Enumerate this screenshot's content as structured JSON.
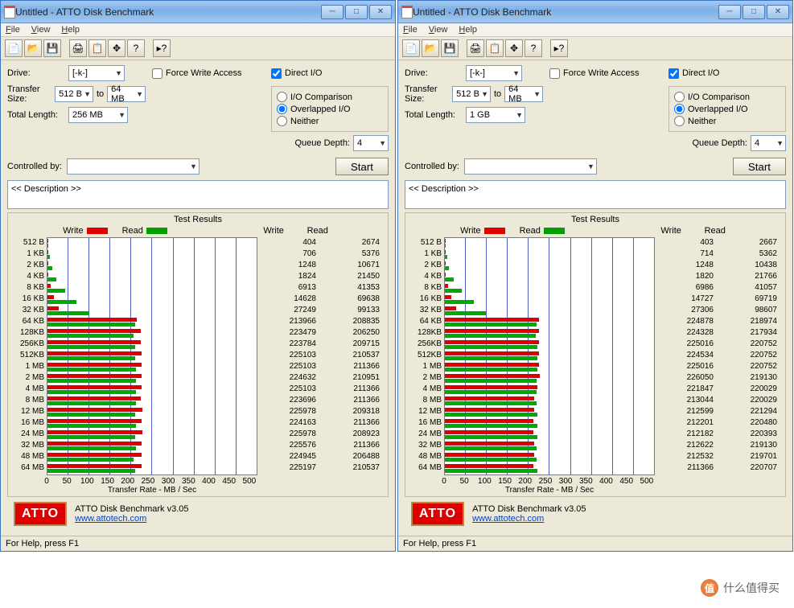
{
  "windows": [
    {
      "title": "Untitled - ATTO Disk Benchmark",
      "menu": {
        "file": "File",
        "view": "View",
        "help": "Help"
      },
      "form": {
        "drive_label": "Drive:",
        "drive_value": "[-k-]",
        "transfer_label": "Transfer Size:",
        "transfer_from": "512 B",
        "transfer_to_label": "to",
        "transfer_to": "64 MB",
        "length_label": "Total Length:",
        "length_value": "256 MB",
        "force_write": "Force Write Access",
        "direct_io": "Direct I/O",
        "io_comparison": "I/O Comparison",
        "overlapped_io": "Overlapped I/O",
        "neither": "Neither",
        "queue_label": "Queue Depth:",
        "queue_value": "4",
        "controlled_label": "Controlled by:",
        "start": "Start",
        "description": "<< Description >>"
      },
      "results_title": "Test Results",
      "legend": {
        "write": "Write",
        "read": "Read"
      },
      "colors": {
        "write": "#e00000",
        "read": "#00a000"
      },
      "value_headers": {
        "write": "Write",
        "read": "Read"
      },
      "chart_data": {
        "type": "bar",
        "xlabel": "Transfer Rate - MB / Sec",
        "xlim": [
          0,
          500
        ],
        "xticks": [
          0,
          50,
          100,
          150,
          200,
          250,
          300,
          350,
          400,
          450,
          500
        ],
        "rows": [
          {
            "label": "512 B",
            "write": 404,
            "read": 2674
          },
          {
            "label": "1 KB",
            "write": 706,
            "read": 5376
          },
          {
            "label": "2 KB",
            "write": 1248,
            "read": 10671
          },
          {
            "label": "4 KB",
            "write": 1824,
            "read": 21450
          },
          {
            "label": "8 KB",
            "write": 6913,
            "read": 41353
          },
          {
            "label": "16 KB",
            "write": 14628,
            "read": 69638
          },
          {
            "label": "32 KB",
            "write": 27249,
            "read": 99133
          },
          {
            "label": "64 KB",
            "write": 213966,
            "read": 208835
          },
          {
            "label": "128KB",
            "write": 223479,
            "read": 206250
          },
          {
            "label": "256KB",
            "write": 223784,
            "read": 209715
          },
          {
            "label": "512KB",
            "write": 225103,
            "read": 210537
          },
          {
            "label": "1 MB",
            "write": 225103,
            "read": 211366
          },
          {
            "label": "2 MB",
            "write": 224632,
            "read": 210951
          },
          {
            "label": "4 MB",
            "write": 225103,
            "read": 211366
          },
          {
            "label": "8 MB",
            "write": 223696,
            "read": 211366
          },
          {
            "label": "12 MB",
            "write": 225978,
            "read": 209318
          },
          {
            "label": "16 MB",
            "write": 224163,
            "read": 211366
          },
          {
            "label": "24 MB",
            "write": 225978,
            "read": 208923
          },
          {
            "label": "32 MB",
            "write": 225576,
            "read": 211366
          },
          {
            "label": "48 MB",
            "write": 224945,
            "read": 206488
          },
          {
            "label": "64 MB",
            "write": 225197,
            "read": 210537
          }
        ]
      },
      "footer": {
        "product": "ATTO Disk Benchmark v3.05",
        "url": "www.attotech.com",
        "logo": "ATTO"
      },
      "status": "For Help, press F1"
    },
    {
      "title": "Untitled - ATTO Disk Benchmark",
      "menu": {
        "file": "File",
        "view": "View",
        "help": "Help"
      },
      "form": {
        "drive_label": "Drive:",
        "drive_value": "[-k-]",
        "transfer_label": "Transfer Size:",
        "transfer_from": "512 B",
        "transfer_to_label": "to",
        "transfer_to": "64 MB",
        "length_label": "Total Length:",
        "length_value": "1 GB",
        "force_write": "Force Write Access",
        "direct_io": "Direct I/O",
        "io_comparison": "I/O Comparison",
        "overlapped_io": "Overlapped I/O",
        "neither": "Neither",
        "queue_label": "Queue Depth:",
        "queue_value": "4",
        "controlled_label": "Controlled by:",
        "start": "Start",
        "description": "<< Description >>"
      },
      "results_title": "Test Results",
      "legend": {
        "write": "Write",
        "read": "Read"
      },
      "colors": {
        "write": "#e00000",
        "read": "#00a000"
      },
      "value_headers": {
        "write": "Write",
        "read": "Read"
      },
      "chart_data": {
        "type": "bar",
        "xlabel": "Transfer Rate - MB / Sec",
        "xlim": [
          0,
          500
        ],
        "xticks": [
          0,
          50,
          100,
          150,
          200,
          250,
          300,
          350,
          400,
          450,
          500
        ],
        "rows": [
          {
            "label": "512 B",
            "write": 403,
            "read": 2667
          },
          {
            "label": "1 KB",
            "write": 714,
            "read": 5362
          },
          {
            "label": "2 KB",
            "write": 1248,
            "read": 10438
          },
          {
            "label": "4 KB",
            "write": 1820,
            "read": 21766
          },
          {
            "label": "8 KB",
            "write": 6986,
            "read": 41057
          },
          {
            "label": "16 KB",
            "write": 14727,
            "read": 69719
          },
          {
            "label": "32 KB",
            "write": 27306,
            "read": 98607
          },
          {
            "label": "64 KB",
            "write": 224878,
            "read": 218974
          },
          {
            "label": "128KB",
            "write": 224328,
            "read": 217934
          },
          {
            "label": "256KB",
            "write": 225016,
            "read": 220752
          },
          {
            "label": "512KB",
            "write": 224534,
            "read": 220752
          },
          {
            "label": "1 MB",
            "write": 225016,
            "read": 220752
          },
          {
            "label": "2 MB",
            "write": 226050,
            "read": 219130
          },
          {
            "label": "4 MB",
            "write": 221847,
            "read": 220029
          },
          {
            "label": "8 MB",
            "write": 213044,
            "read": 220029
          },
          {
            "label": "12 MB",
            "write": 212599,
            "read": 221294
          },
          {
            "label": "16 MB",
            "write": 212201,
            "read": 220480
          },
          {
            "label": "24 MB",
            "write": 212182,
            "read": 220393
          },
          {
            "label": "32 MB",
            "write": 212622,
            "read": 219130
          },
          {
            "label": "48 MB",
            "write": 212532,
            "read": 219701
          },
          {
            "label": "64 MB",
            "write": 211366,
            "read": 220707
          }
        ]
      },
      "footer": {
        "product": "ATTO Disk Benchmark v3.05",
        "url": "www.attotech.com",
        "logo": "ATTO"
      },
      "status": "For Help, press F1"
    }
  ],
  "watermark": {
    "text": "什么值得买",
    "icon": "值"
  }
}
